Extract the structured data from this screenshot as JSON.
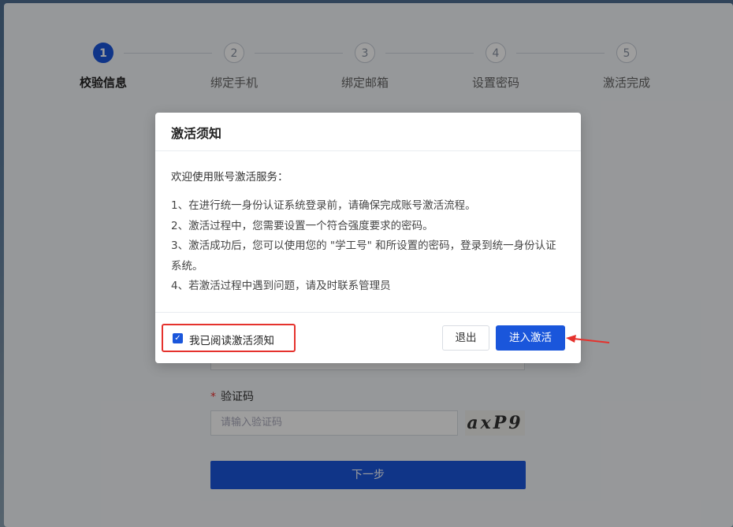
{
  "steps": [
    {
      "num": "1",
      "label": "校验信息",
      "active": true
    },
    {
      "num": "2",
      "label": "绑定手机",
      "active": false
    },
    {
      "num": "3",
      "label": "绑定邮箱",
      "active": false
    },
    {
      "num": "4",
      "label": "设置密码",
      "active": false
    },
    {
      "num": "5",
      "label": "激活完成",
      "active": false
    }
  ],
  "form": {
    "captcha_label": "验证码",
    "captcha_required_mark": "*",
    "captcha_placeholder": "请输入验证码",
    "captcha_text": "axP9",
    "next_button": "下一步"
  },
  "modal": {
    "title": "激活须知",
    "intro": "欢迎使用账号激活服务：",
    "rules": [
      "1、在进行统一身份认证系统登录前，请确保完成账号激活流程。",
      "2、激活过程中，您需要设置一个符合强度要求的密码。",
      "3、激活成功后，您可以使用您的 \"学工号\" 和所设置的密码，登录到统一身份认证系统。",
      "4、若激活过程中遇到问题，请及时联系管理员"
    ],
    "agree_label": "我已阅读激活须知",
    "agree_checked": true,
    "exit_button": "退出",
    "activate_button": "进入激活"
  },
  "colors": {
    "accent": "#1a56db",
    "highlight": "#e5322d"
  }
}
